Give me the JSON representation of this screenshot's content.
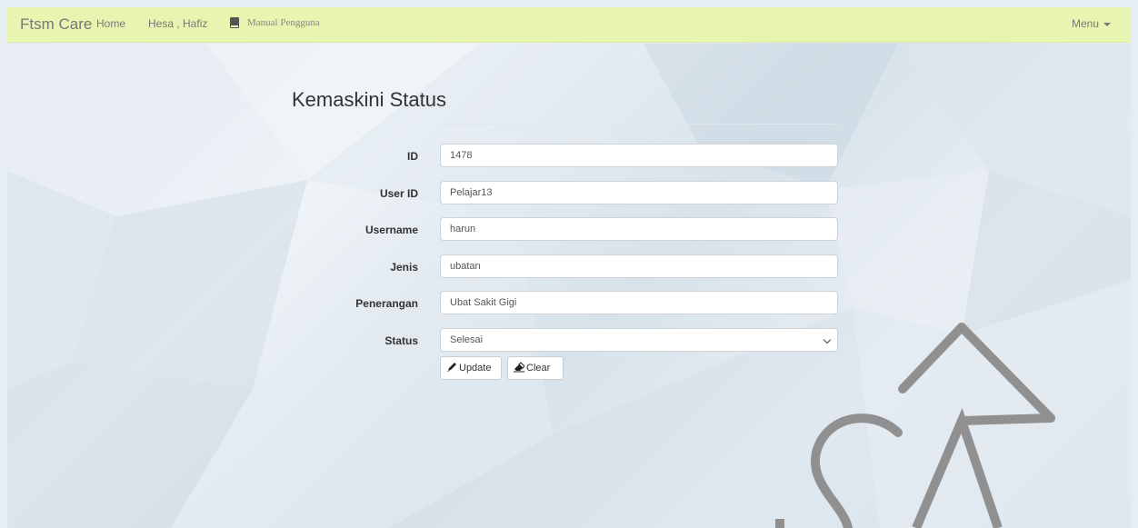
{
  "navbar": {
    "brand": "Ftsm Care",
    "home": "Home",
    "user": "Hesa , Hafiz",
    "manual": "Manual Pengguna",
    "menu": "Menu"
  },
  "page": {
    "title": "Kemaskini Status"
  },
  "form": {
    "fields": [
      {
        "label": "ID",
        "value": "1478"
      },
      {
        "label": "User ID",
        "value": "Pelajar13"
      },
      {
        "label": "Username",
        "value": "harun"
      },
      {
        "label": "Jenis",
        "value": "ubatan"
      },
      {
        "label": "Penerangan",
        "value": "Ubat Sakit Gigi"
      },
      {
        "label": "Status",
        "value": "Selesai"
      }
    ],
    "update_label": "Update",
    "clear_label": "Clear"
  },
  "icons": {
    "book": "book-icon",
    "caret": "caret-down-icon",
    "pencil": "pencil-icon",
    "eraser": "eraser-icon",
    "chevron": "chevron-down-icon"
  },
  "colors": {
    "navbar_bg": "#e8f5b0",
    "page_bg": "#e6edf3",
    "watermark": "#909090"
  }
}
